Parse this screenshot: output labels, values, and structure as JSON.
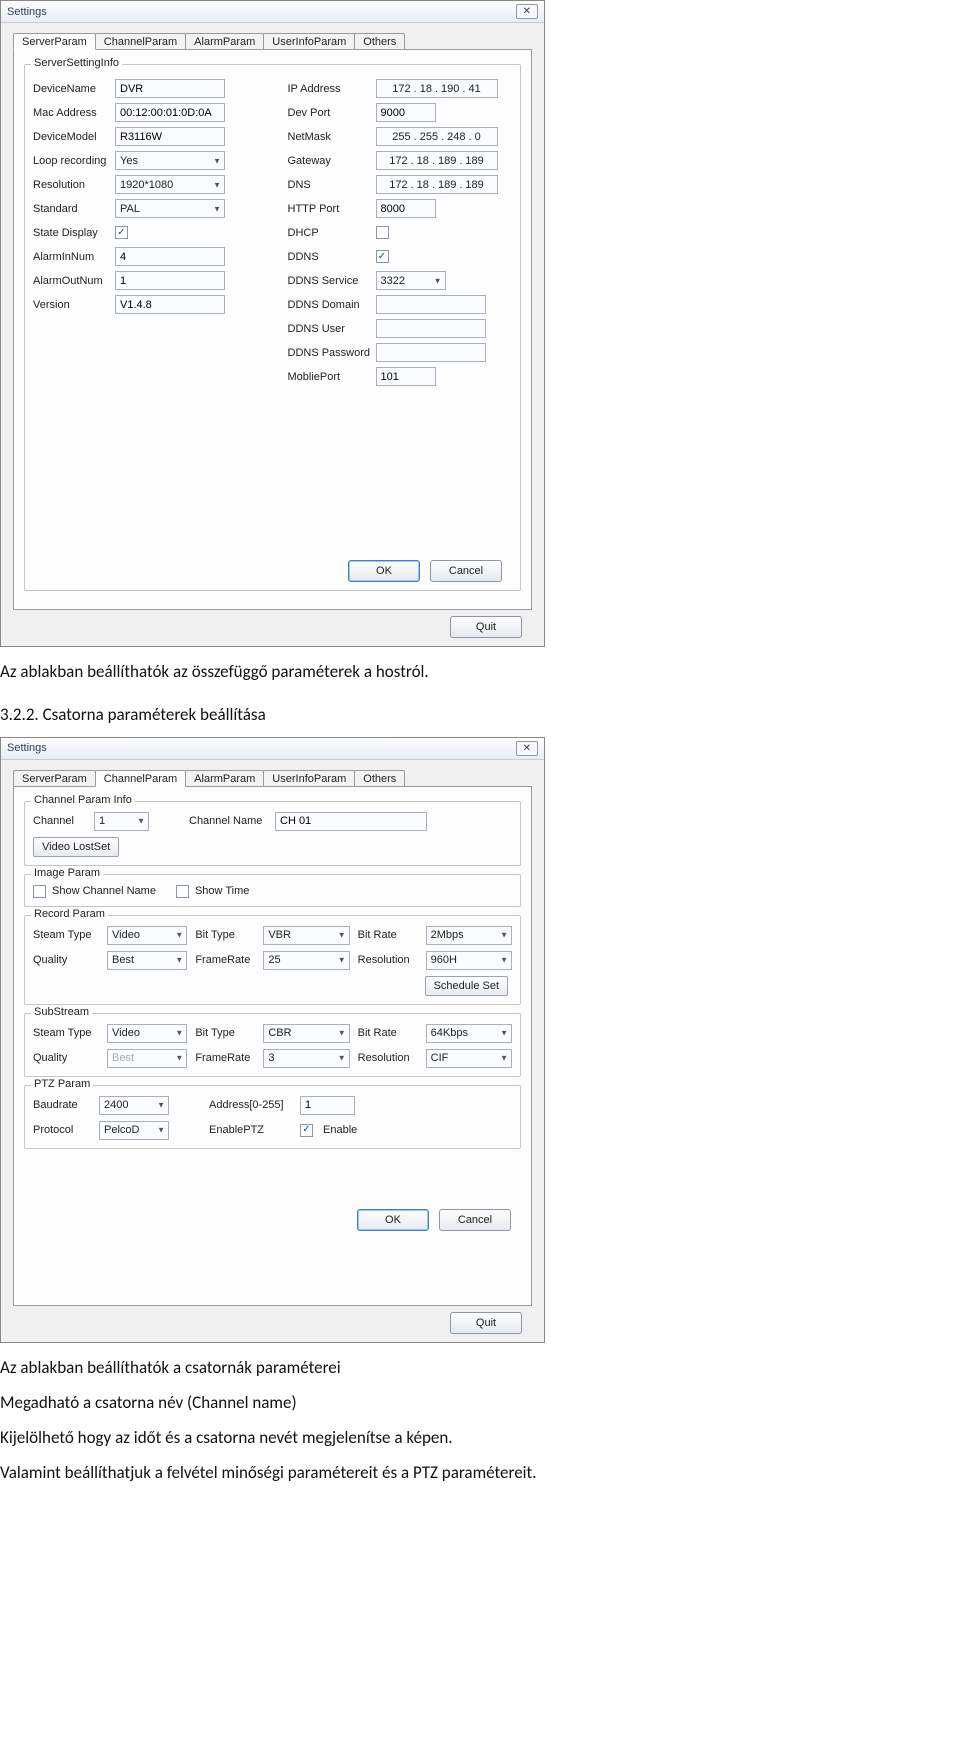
{
  "dialog1": {
    "title": "Settings",
    "close_glyph": "✕",
    "tabs": {
      "server": "ServerParam",
      "channel": "ChannelParam",
      "alarm": "AlarmParam",
      "userinfo": "UserInfoParam",
      "others": "Others"
    },
    "group_title": "ServerSettingInfo",
    "left": {
      "device_name_l": "DeviceName",
      "device_name_v": "DVR",
      "mac_l": "Mac Address",
      "mac_v": "00:12:00:01:0D:0A",
      "model_l": "DeviceModel",
      "model_v": "R3116W",
      "loop_l": "Loop recording",
      "loop_v": "Yes",
      "res_l": "Resolution",
      "res_v": "1920*1080",
      "std_l": "Standard",
      "std_v": "PAL",
      "state_l": "State Display",
      "ain_l": "AlarmInNum",
      "ain_v": "4",
      "aout_l": "AlarmOutNum",
      "aout_v": "1",
      "ver_l": "Version",
      "ver_v": "V1.4.8"
    },
    "right": {
      "ip_l": "IP Address",
      "ip_v": [
        "172",
        "18",
        "190",
        "41"
      ],
      "port_l": "Dev Port",
      "port_v": "9000",
      "mask_l": "NetMask",
      "mask_v": [
        "255",
        "255",
        "248",
        "0"
      ],
      "gw_l": "Gateway",
      "gw_v": [
        "172",
        "18",
        "189",
        "189"
      ],
      "dns_l": "DNS",
      "dns_v": [
        "172",
        "18",
        "189",
        "189"
      ],
      "http_l": "HTTP Port",
      "http_v": "8000",
      "dhcp_l": "DHCP",
      "ddns_l": "DDNS",
      "ddns_srv_l": "DDNS Service",
      "ddns_srv_v": "3322",
      "ddns_dom_l": "DDNS Domain",
      "ddns_user_l": "DDNS User",
      "ddns_pwd_l": "DDNS Password",
      "mobile_l": "MobliePort",
      "mobile_v": "101"
    },
    "ok": "OK",
    "cancel": "Cancel",
    "quit": "Quit"
  },
  "doc": {
    "p1": "Az ablakban beállíthatók az összefüggő paraméterek a hostról.",
    "h1": "3.2.2. Csatorna paraméterek beállítása",
    "p2": "Az ablakban beállíthatók a csatornák paraméterei",
    "p3": "Megadható a csatorna név (Channel name)",
    "p4": "Kijelölhető hogy az időt és a csatorna nevét megjelenítse a képen.",
    "p5": "Valamint beállíthatjuk a felvétel minőségi paramétereit és a PTZ paramétereit."
  },
  "dialog2": {
    "title": "Settings",
    "close_glyph": "✕",
    "tabs": {
      "server": "ServerParam",
      "channel": "ChannelParam",
      "alarm": "AlarmParam",
      "userinfo": "UserInfoParam",
      "others": "Others"
    },
    "g1_title": "Channel Param Info",
    "g1": {
      "ch_l": "Channel",
      "ch_v": "1",
      "chname_l": "Channel Name",
      "chname_v": "CH 01",
      "vlost_btn": "Video LostSet"
    },
    "g2_title": "Image Param",
    "g2": {
      "showch_l": "Show Channel Name",
      "showtime_l": "Show Time"
    },
    "g3_title": "Record Param",
    "g3": {
      "steam_l": "Steam Type",
      "steam_v": "Video",
      "bittype_l": "Bit Type",
      "bittype_v": "VBR",
      "bitrate_l": "Bit Rate",
      "bitrate_v": "2Mbps",
      "quality_l": "Quality",
      "quality_v": "Best",
      "fps_l": "FrameRate",
      "fps_v": "25",
      "res_l": "Resolution",
      "res_v": "960H",
      "sched_btn": "Schedule Set"
    },
    "g4_title": "SubStream",
    "g4": {
      "steam_l": "Steam Type",
      "steam_v": "Video",
      "bittype_l": "Bit Type",
      "bittype_v": "CBR",
      "bitrate_l": "Bit Rate",
      "bitrate_v": "64Kbps",
      "quality_l": "Quality",
      "quality_v": "Best",
      "fps_l": "FrameRate",
      "fps_v": "3",
      "res_l": "Resolution",
      "res_v": "CIF"
    },
    "g5_title": "PTZ Param",
    "g5": {
      "baud_l": "Baudrate",
      "baud_v": "2400",
      "addr_l": "Address[0-255]",
      "addr_v": "1",
      "proto_l": "Protocol",
      "proto_v": "PelcoD",
      "eptz_l": "EnablePTZ",
      "enable_l": "Enable"
    },
    "ok": "OK",
    "cancel": "Cancel",
    "quit": "Quit"
  }
}
